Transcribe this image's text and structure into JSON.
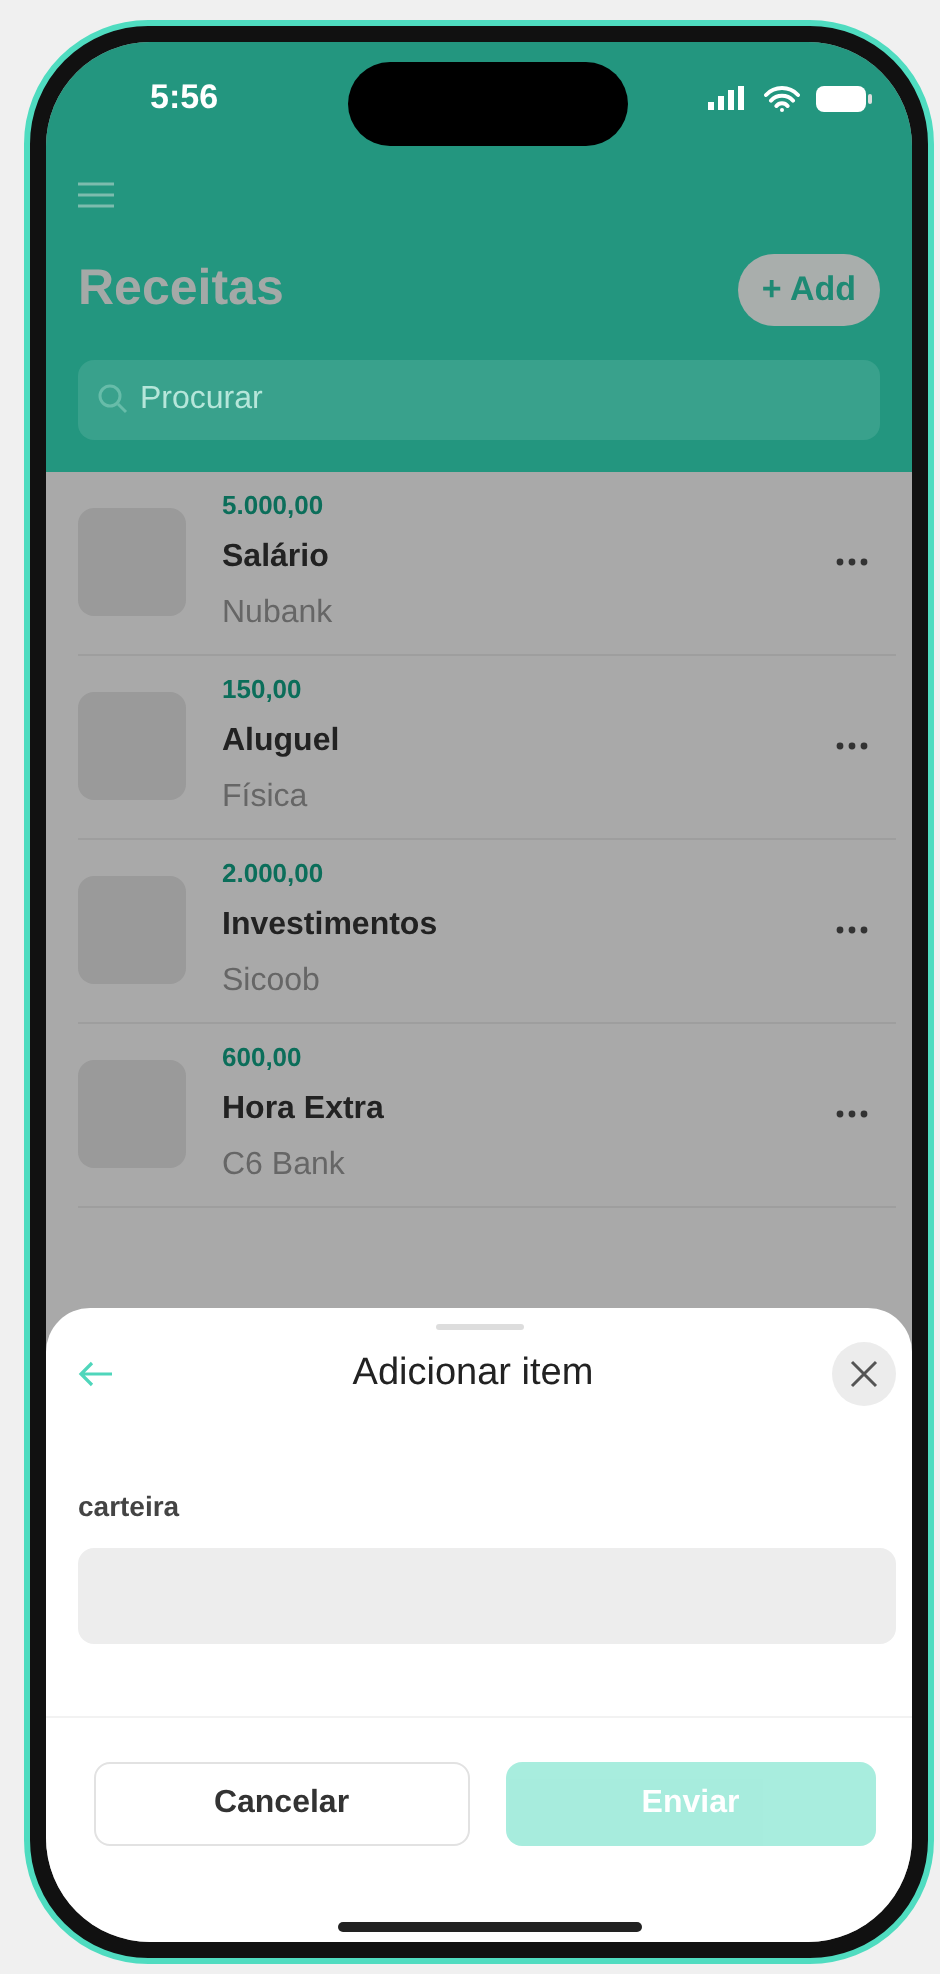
{
  "status_bar": {
    "time": "5:56"
  },
  "header": {
    "title": "Receitas",
    "add_button": "+ Add",
    "search": {
      "placeholder": "Procurar"
    }
  },
  "items": [
    {
      "amount": "5.000,00",
      "name": "Salário",
      "account": "Nubank"
    },
    {
      "amount": "150,00",
      "name": "Aluguel",
      "account": "Física"
    },
    {
      "amount": "2.000,00",
      "name": "Investimentos",
      "account": "Sicoob"
    },
    {
      "amount": "600,00",
      "name": "Hora Extra",
      "account": "C6 Bank"
    }
  ],
  "sheet": {
    "title": "Adicionar item",
    "field": {
      "label": "carteira"
    },
    "buttons": [
      {
        "label": "Cancelar",
        "kind": "secondary",
        "disabled": false
      },
      {
        "label": "Enviar",
        "kind": "primary",
        "disabled": true
      }
    ]
  }
}
